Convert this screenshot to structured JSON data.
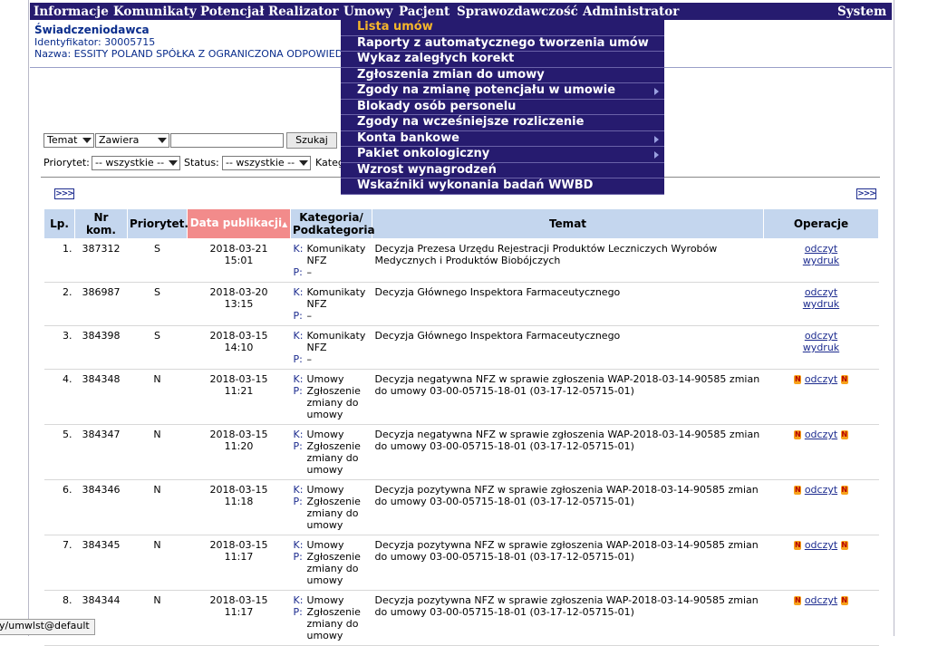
{
  "menubar": {
    "items": [
      "Informacje",
      "Komunikaty",
      "Potencjał",
      "Realizator",
      "Umowy",
      "Pacjent",
      "Sprawozdawczość",
      "Administrator"
    ],
    "system": "System"
  },
  "provider": {
    "title": "Świadczeniodawca",
    "id_line": "Identyfikator: 30005715",
    "name_line": "Nazwa: ESSITY POLAND SPÓŁKA Z OGRANICZONA ODPOWIED"
  },
  "filters": {
    "field_select": "Temat",
    "mode_select": "Zawiera",
    "search_value": "",
    "search_button": "Szukaj",
    "priority_label": "Priorytet:",
    "priority_value": "-- wszystkie --",
    "status_label": "Status:",
    "status_value": "-- wszystkie --",
    "category_label": "Kateg"
  },
  "pager": {
    "next": ">>>"
  },
  "table": {
    "headers": {
      "lp": "Lp.",
      "nr": "Nr kom.",
      "priority": "Priorytet.",
      "date": "Data publikacji",
      "category": "Kategoria/ Podkategoria",
      "topic": "Temat",
      "ops": "Operacje"
    },
    "sort_indicator": "▲",
    "k_prefix": "K:",
    "p_prefix": "P:",
    "rows": [
      {
        "lp": "1.",
        "nr": "387312",
        "priority": "S",
        "date": "2018-03-21",
        "time": "15:01",
        "k": "Komunikaty NFZ",
        "p": "–",
        "topic": "Decyzja Prezesa Urzędu Rejestracji Produktów Leczniczych Wyrobów Medycznych i Produktów Biobójczych",
        "op1": "odczyt",
        "op2": "wydruk",
        "flag": false
      },
      {
        "lp": "2.",
        "nr": "386987",
        "priority": "S",
        "date": "2018-03-20",
        "time": "13:15",
        "k": "Komunikaty NFZ",
        "p": "–",
        "topic": "Decyzja Głównego Inspektora Farmaceutycznego",
        "op1": "odczyt",
        "op2": "wydruk",
        "flag": false
      },
      {
        "lp": "3.",
        "nr": "384398",
        "priority": "S",
        "date": "2018-03-15",
        "time": "14:10",
        "k": "Komunikaty NFZ",
        "p": "–",
        "topic": "Decyzja Głównego Inspektora Farmaceutycznego",
        "op1": "odczyt",
        "op2": "wydruk",
        "flag": false
      },
      {
        "lp": "4.",
        "nr": "384348",
        "priority": "N",
        "date": "2018-03-15",
        "time": "11:21",
        "k": "Umowy",
        "p": "Zgłoszenie zmiany do umowy",
        "topic": "Decyzja negatywna NFZ w sprawie zgłoszenia WAP-2018-03-14-90585 zmian do umowy 03-00-05715-18-01 (03-17-12-05715-01)",
        "op1": "odczyt",
        "op2": "",
        "flag": true
      },
      {
        "lp": "5.",
        "nr": "384347",
        "priority": "N",
        "date": "2018-03-15",
        "time": "11:20",
        "k": "Umowy",
        "p": "Zgłoszenie zmiany do umowy",
        "topic": "Decyzja negatywna NFZ w sprawie zgłoszenia WAP-2018-03-14-90585 zmian do umowy 03-00-05715-18-01 (03-17-12-05715-01)",
        "op1": "odczyt",
        "op2": "",
        "flag": true
      },
      {
        "lp": "6.",
        "nr": "384346",
        "priority": "N",
        "date": "2018-03-15",
        "time": "11:18",
        "k": "Umowy",
        "p": "Zgłoszenie zmiany do umowy",
        "topic": "Decyzja pozytywna NFZ w sprawie zgłoszenia WAP-2018-03-14-90585 zmian do umowy 03-00-05715-18-01 (03-17-12-05715-01)",
        "op1": "odczyt",
        "op2": "",
        "flag": true
      },
      {
        "lp": "7.",
        "nr": "384345",
        "priority": "N",
        "date": "2018-03-15",
        "time": "11:17",
        "k": "Umowy",
        "p": "Zgłoszenie zmiany do umowy",
        "topic": "Decyzja pozytywna NFZ w sprawie zgłoszenia WAP-2018-03-14-90585 zmian do umowy 03-00-05715-18-01 (03-17-12-05715-01)",
        "op1": "odczyt",
        "op2": "",
        "flag": true
      },
      {
        "lp": "8.",
        "nr": "384344",
        "priority": "N",
        "date": "2018-03-15",
        "time": "11:17",
        "k": "Umowy",
        "p": "Zgłoszenie zmiany do umowy",
        "topic": "Decyzja pozytywna NFZ w sprawie zgłoszenia WAP-2018-03-14-90585 zmian do umowy 03-00-05715-18-01 (03-17-12-05715-01)",
        "op1": "odczyt",
        "op2": "",
        "flag": true
      }
    ],
    "flag_glyph": "N"
  },
  "dropdown": {
    "items": [
      {
        "label": "Lista umów",
        "active": true,
        "submenu": false
      },
      {
        "label": "Raporty z automatycznego tworzenia umów",
        "active": false,
        "submenu": false
      },
      {
        "label": "Wykaz zaległych korekt",
        "active": false,
        "submenu": false
      },
      {
        "label": "Zgłoszenia zmian do umowy",
        "active": false,
        "submenu": false
      },
      {
        "label": "Zgody na zmianę potencjału w umowie",
        "active": false,
        "submenu": true
      },
      {
        "label": "Blokady osób personelu",
        "active": false,
        "submenu": false
      },
      {
        "label": "Zgody na wcześniejsze rozliczenie",
        "active": false,
        "submenu": false
      },
      {
        "label": "Konta bankowe",
        "active": false,
        "submenu": true
      },
      {
        "label": "Pakiet onkologiczny",
        "active": false,
        "submenu": true
      },
      {
        "label": "Wzrost wynagrodzeń",
        "active": false,
        "submenu": false
      },
      {
        "label": "Wskaźniki wykonania badań WWBD",
        "active": false,
        "submenu": false
      }
    ]
  },
  "statusbar": {
    "text": "y/umwlst@default"
  },
  "colors": {
    "menubar": "#261b6f",
    "header_bg": "#c4d6ee",
    "sorted_header_bg": "#f28b8b",
    "link": "#1d2c8f",
    "active_menu": "#f5b62b"
  }
}
